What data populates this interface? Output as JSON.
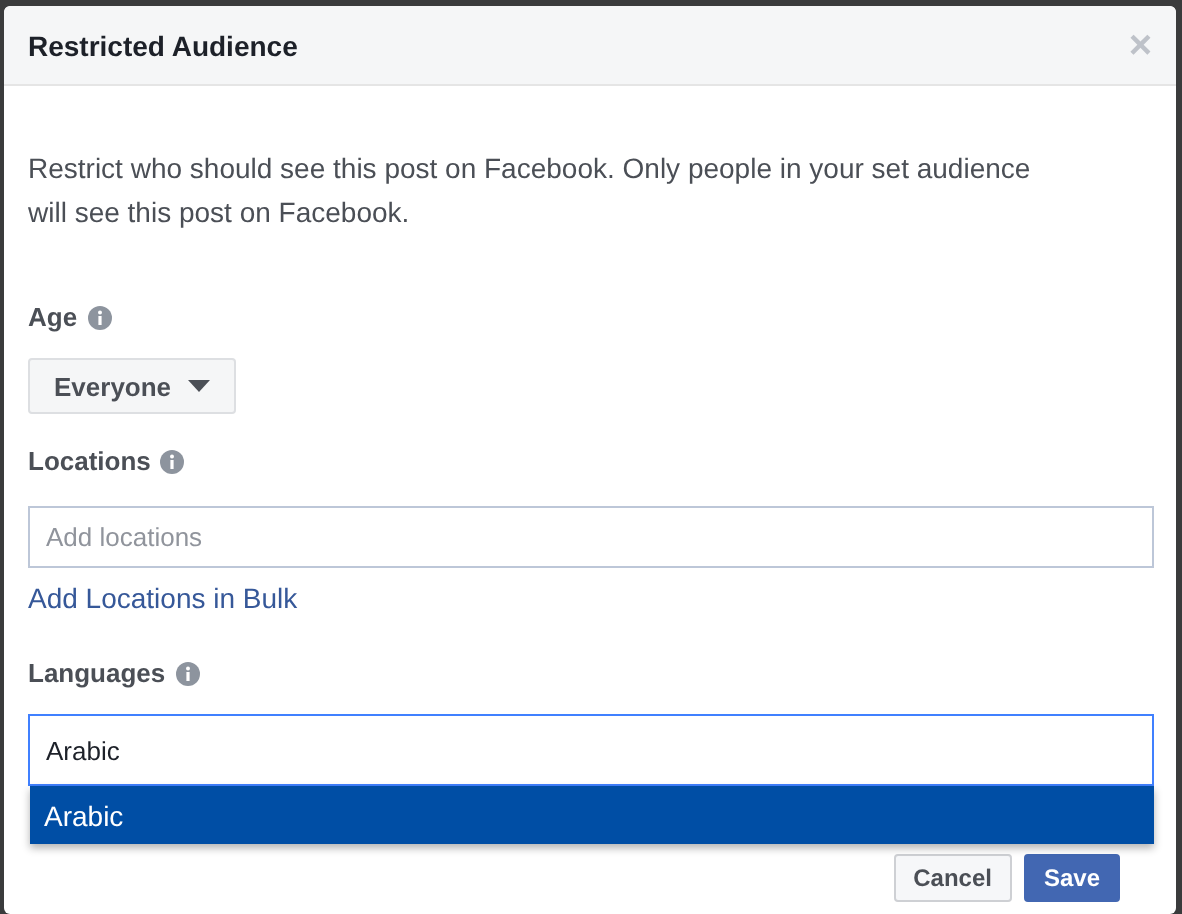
{
  "dialog": {
    "title": "Restricted Audience",
    "close": "×"
  },
  "description": "Restrict who should see this post on Facebook. Only people in your set audience will see this post on Facebook.",
  "age": {
    "label": "Age",
    "value": "Everyone"
  },
  "locations": {
    "label": "Locations",
    "placeholder": "Add locations",
    "link": "Add Locations in Bulk"
  },
  "languages": {
    "label": "Languages",
    "value": "Arabic",
    "suggestions": [
      {
        "label": "Arabic",
        "selected": true
      }
    ]
  },
  "buttons": [
    {
      "label": "Cancel",
      "kind": "secondary"
    },
    {
      "label": "Save",
      "kind": "primary"
    }
  ]
}
